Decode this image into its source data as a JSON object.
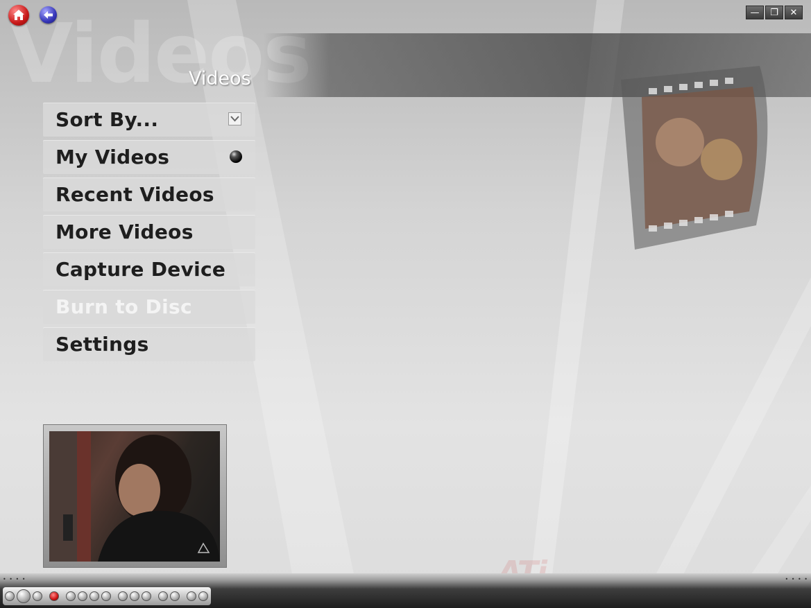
{
  "window": {
    "title_watermark": "Videos",
    "page_title": "Videos",
    "controls": {
      "minimize": "—",
      "restore": "❐",
      "close": "✕"
    }
  },
  "nav": {
    "home_icon": "home-icon",
    "back_icon": "back-arrow-icon"
  },
  "menu": {
    "items": [
      {
        "label": "Sort By...",
        "indicator": "dropdown",
        "state": "enabled"
      },
      {
        "label": "My Videos",
        "indicator": "selected-dot",
        "state": "selected"
      },
      {
        "label": "Recent Videos",
        "indicator": "",
        "state": "enabled"
      },
      {
        "label": "More Videos",
        "indicator": "",
        "state": "enabled"
      },
      {
        "label": "Capture Device",
        "indicator": "",
        "state": "enabled"
      },
      {
        "label": "Burn to Disc",
        "indicator": "",
        "state": "disabled"
      },
      {
        "label": "Settings",
        "indicator": "",
        "state": "enabled"
      }
    ]
  },
  "brand": {
    "logo_text": "ATi",
    "accent": "#c81818"
  },
  "transport_bar": {
    "buttons": [
      "power",
      "play",
      "stop",
      "record",
      "rewind",
      "forward",
      "skip-back",
      "skip-forward",
      "prev",
      "next",
      "pause",
      "slow",
      "step",
      "eject",
      "menu",
      "mute"
    ]
  }
}
